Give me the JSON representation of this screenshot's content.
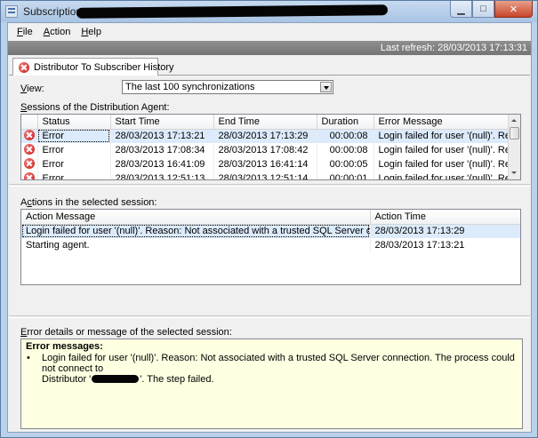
{
  "window": {
    "title": "Subscription"
  },
  "menu": {
    "items": [
      {
        "label": "File",
        "accel": "F",
        "rest": "ile"
      },
      {
        "label": "Action",
        "accel": "A",
        "rest": "ction"
      },
      {
        "label": "Help",
        "accel": "H",
        "rest": "elp"
      }
    ]
  },
  "status": {
    "last_refresh": "Last refresh: 28/03/2013 17:13:31"
  },
  "tab": {
    "label": "Distributor To Subscriber History"
  },
  "view": {
    "label_accel": "V",
    "label_rest": "iew:",
    "selected": "The last 100 synchronizations"
  },
  "sessions": {
    "label_accel": "S",
    "label_rest": "essions of the Distribution Agent:",
    "columns": [
      "Status",
      "Start Time",
      "End Time",
      "Duration",
      "Error Message"
    ],
    "rows": [
      {
        "status": "Error",
        "start": "28/03/2013 17:13:21",
        "end": "28/03/2013 17:13:29",
        "duration": "00:00:08",
        "error": "Login failed for user '(null)'. Reason: Not associated with a trusted SQL Server connection."
      },
      {
        "status": "Error",
        "start": "28/03/2013 17:08:34",
        "end": "28/03/2013 17:08:42",
        "duration": "00:00:08",
        "error": "Login failed for user '(null)'. Reason: Not associated with a trusted SQL Server connection."
      },
      {
        "status": "Error",
        "start": "28/03/2013 16:41:09",
        "end": "28/03/2013 16:41:14",
        "duration": "00:00:05",
        "error": "Login failed for user '(null)'. Reason: Not associated with a trusted SQL Server connection."
      },
      {
        "status": "Error",
        "start": "28/03/2013 12:51:13",
        "end": "28/03/2013 12:51:14",
        "duration": "00:00:01",
        "error": "Login failed for user '(null)'. Reason: Not associated with a trusted SQL Server connection."
      }
    ]
  },
  "actions": {
    "label_before": "A",
    "label_accel": "c",
    "label_rest": "tions in the selected session:",
    "columns": [
      "Action Message",
      "Action Time"
    ],
    "rows": [
      {
        "message": "Login failed for user '(null)'. Reason: Not associated with a trusted SQL Server connection. T...",
        "time": "28/03/2013 17:13:29"
      },
      {
        "message": "Starting agent.",
        "time": "28/03/2013 17:13:21"
      }
    ]
  },
  "details": {
    "label_accel": "E",
    "label_rest": "rror details or message of the selected session:",
    "heading": "Error messages:",
    "bullet": "•",
    "message_line1": "Login failed for user '(null)'. Reason: Not associated with a trusted SQL Server connection. The process could not connect to",
    "message_prefix": "Distributor '",
    "message_suffix": "'.  The step failed."
  }
}
